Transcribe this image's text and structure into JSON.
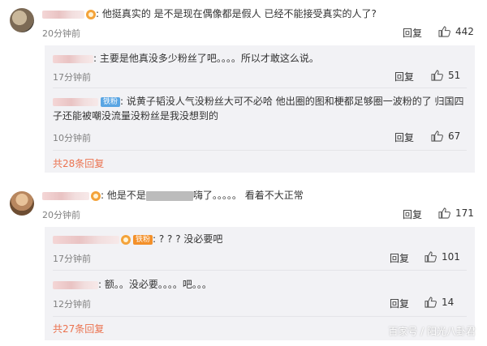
{
  "thread1": {
    "main": {
      "text": "他挺真实的 是不是现在偶像都是假人 已经不能接受真实的人了?",
      "time": "20分钟前",
      "reply": "回复",
      "likes": "442"
    },
    "subs": [
      {
        "text": "主要是他真没多少粉丝了吧。。。。所以才敢这么说。",
        "time": "17分钟前",
        "reply": "回复",
        "likes": "51"
      },
      {
        "badge": "铁粉",
        "text": "说黄子韬没人气没粉丝大可不必哈 他出圈的图和梗都足够圈一波粉的了 归国四子还能被嘲没流量没粉丝是我没想到的",
        "time": "10分钟前",
        "reply": "回复",
        "likes": "67"
      }
    ],
    "more": "共28条回复"
  },
  "thread2": {
    "main": {
      "text_a": "他是不是",
      "text_b": "嗨了。。。。。 看着不大正常",
      "time": "20分钟前",
      "reply": "回复",
      "likes": "171"
    },
    "subs": [
      {
        "badge": "铁粉",
        "text": "? ? ? 没必要吧",
        "time": "17分钟前",
        "reply": "回复",
        "likes": "101"
      },
      {
        "text": "额。。没必要。。。。吧。。。",
        "time": "12分钟前",
        "reply": "回复",
        "likes": "14"
      }
    ],
    "more": "共27条回复"
  },
  "watermark": "百家号 / 阳光八卦君"
}
